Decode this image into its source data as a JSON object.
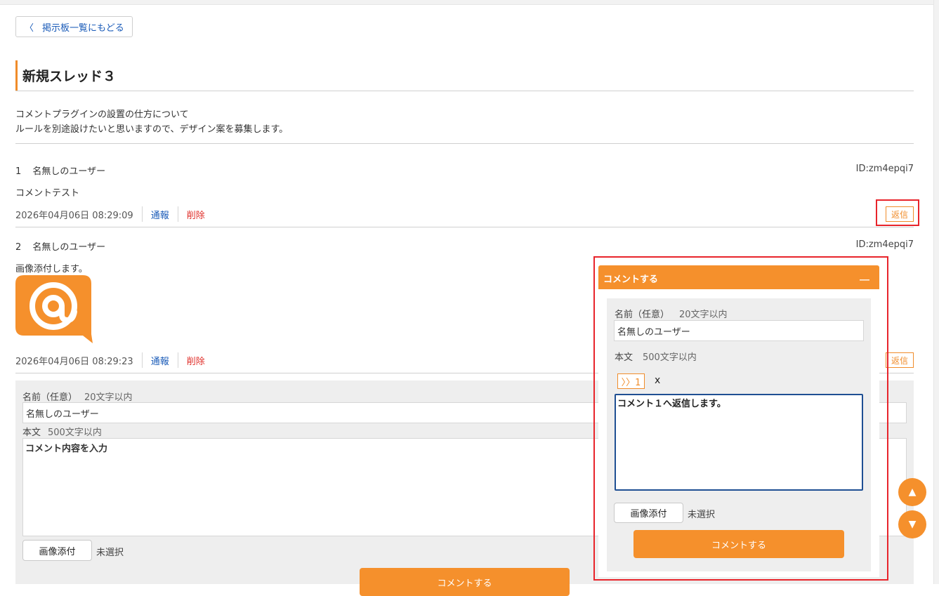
{
  "nav": {
    "back_chevron": "〈",
    "back_label": "掲示板一覧にもどる"
  },
  "thread": {
    "title": "新規スレッド３",
    "description_lines": [
      "コメントプラグインの設置の仕方について",
      "ルールを別途設けたいと思いますので、デザイン案を募集します。"
    ]
  },
  "posts": [
    {
      "number": "1",
      "author": "名無しのユーザー",
      "id_label": "ID:zm4epqi7",
      "body": "コメントテスト",
      "timestamp": "2026年04月06日 08:29:09",
      "report_label": "通報",
      "delete_label": "削除",
      "reply_label": "返信"
    },
    {
      "number": "2",
      "author": "名無しのユーザー",
      "id_label": "ID:zm4epqi7",
      "body": "画像添付します。",
      "image_icon": "at-sign-speech-bubble-icon",
      "timestamp": "2026年04月06日 08:29:23",
      "report_label": "通報",
      "delete_label": "削除",
      "reply_label": "返信"
    }
  ],
  "comment_form": {
    "name_label": "名前（任意）",
    "name_hint": "20文字以内",
    "name_value": "名無しのユーザー",
    "body_label": "本文",
    "body_hint": "500文字以内",
    "body_placeholder": "コメント内容を入力",
    "attach_label": "画像添付",
    "attach_status": "未選択",
    "submit_label": "コメントする"
  },
  "floating_panel": {
    "header_title": "コメントする",
    "minimize_glyph": "__",
    "name_label": "名前（任意）",
    "name_hint": "20文字以内",
    "name_value": "名無しのユーザー",
    "body_label": "本文",
    "body_hint": "500文字以内",
    "quote_chip": "〉〉1",
    "quote_remove": "x",
    "body_value": "コメント１へ返信します。",
    "attach_label": "画像添付",
    "attach_status": "未選択",
    "submit_label": "コメントする"
  },
  "scroll": {
    "up_glyph": "▲",
    "down_glyph": "▼"
  },
  "colors": {
    "accent": "#f5902c",
    "link": "#1a5bb8",
    "danger": "#e0302b",
    "highlight_box": "#e8242b",
    "focus_border": "#1f4f93"
  }
}
